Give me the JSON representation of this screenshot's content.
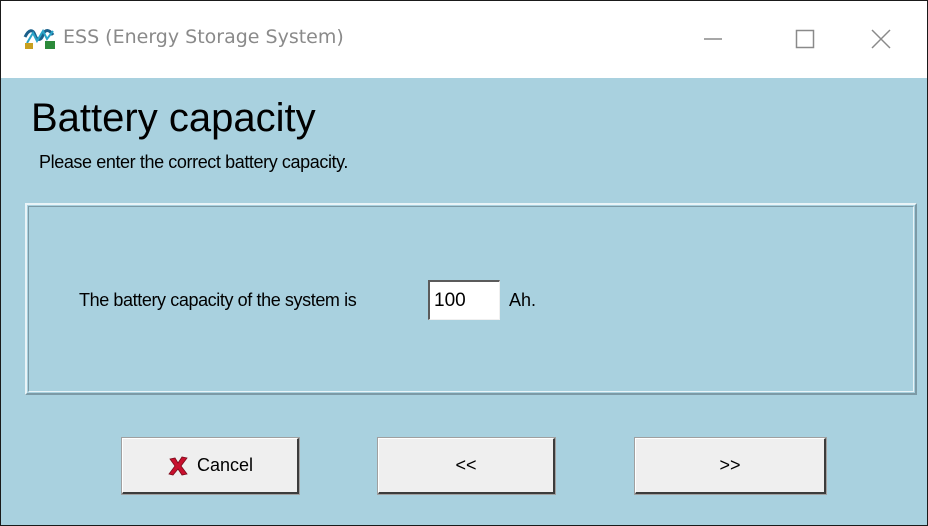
{
  "window": {
    "title": "ESS (Energy Storage System)",
    "icon": "ess-app-icon",
    "controls": {
      "minimize": "minimize-icon",
      "maximize": "maximize-icon",
      "close": "close-icon"
    }
  },
  "page": {
    "heading": "Battery capacity",
    "subheading": "Please enter the correct battery capacity."
  },
  "form": {
    "prompt": "The battery capacity of the system is",
    "capacity_value": "100",
    "unit": "Ah."
  },
  "buttons": {
    "cancel": "Cancel",
    "back": "<<",
    "next": ">>"
  },
  "colors": {
    "background": "#a9d1df",
    "cancel_icon": "#c8102e"
  }
}
